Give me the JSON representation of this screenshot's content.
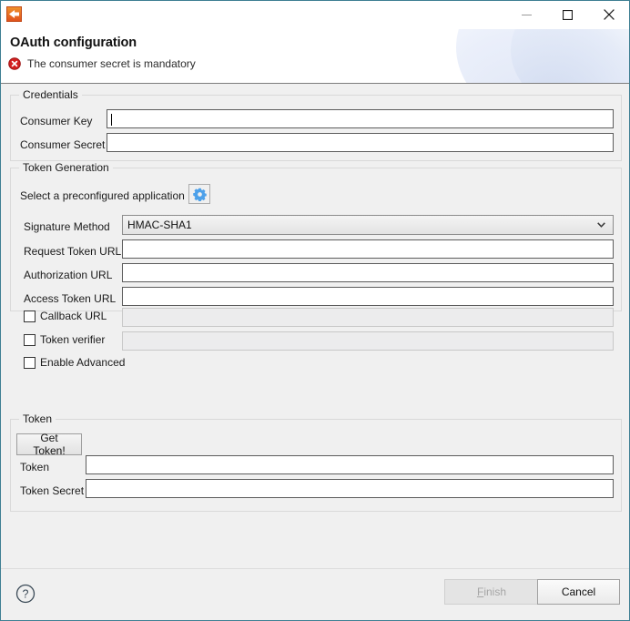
{
  "window": {
    "app_icon": "soapui-app-icon",
    "controls": {
      "minimize": "minimize-icon",
      "maximize": "maximize-icon",
      "close": "close-icon"
    }
  },
  "header": {
    "title": "OAuth configuration",
    "message": "The consumer secret is mandatory",
    "message_icon": "error-icon",
    "message_type": "error",
    "error_color": "#d32020"
  },
  "credentials": {
    "legend": "Credentials",
    "fields": [
      {
        "label": "Consumer Key",
        "value": "",
        "focused": true,
        "enabled": true
      },
      {
        "label": "Consumer Secret",
        "value": "",
        "focused": false,
        "enabled": true
      }
    ]
  },
  "token_generation": {
    "legend": "Token Generation",
    "preconfigured_label": "Select a preconfigured application",
    "preconfigured_icon": "gear-icon",
    "gear_color": "#4da1ea",
    "signature_method": {
      "label": "Signature Method",
      "value": "HMAC-SHA1",
      "chevron": "chevron-down-icon"
    },
    "urls": [
      {
        "label": "Request Token URL",
        "value": "",
        "enabled": true
      },
      {
        "label": "Authorization URL",
        "value": "",
        "enabled": true
      },
      {
        "label": "Access Token URL",
        "value": "",
        "enabled": true
      }
    ],
    "optional": [
      {
        "label": "Callback URL",
        "checked": false,
        "value": "",
        "enabled": false,
        "has_field": true
      },
      {
        "label": "Token verifier",
        "checked": false,
        "value": "",
        "enabled": false,
        "has_field": true
      },
      {
        "label": "Enable Advanced",
        "checked": false,
        "has_field": false
      }
    ]
  },
  "token": {
    "legend": "Token",
    "get_token_label": "Get Token!",
    "fields": [
      {
        "label": "Token",
        "value": "",
        "enabled": true
      },
      {
        "label": "Token Secret",
        "value": "",
        "enabled": true
      }
    ]
  },
  "footer": {
    "help_icon": "help-icon",
    "finish_label": "Finish",
    "finish_mnemonic": "F",
    "finish_rest": "inish",
    "finish_enabled": false,
    "cancel_label": "Cancel",
    "cancel_enabled": true
  }
}
